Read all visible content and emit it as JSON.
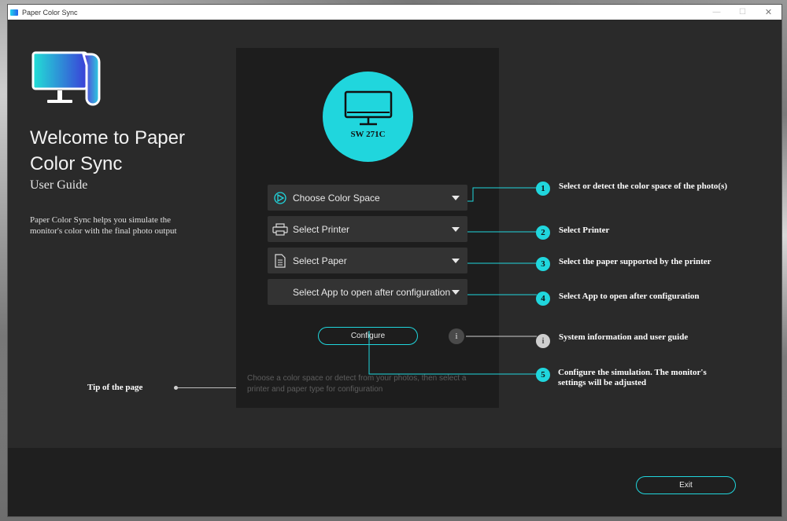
{
  "window": {
    "title": "Paper Color Sync",
    "minimize": "—",
    "maximize": "☐",
    "close": "✕"
  },
  "left": {
    "welcome": "Welcome to Paper Color Sync",
    "guide": "User Guide",
    "description": "Paper Color Sync helps you simulate the monitor's color with the final photo output",
    "tip_label": "Tip of the page"
  },
  "panel": {
    "model": "SW 271C",
    "selects": [
      {
        "label": "Choose Color Space",
        "icon": "color-space-icon"
      },
      {
        "label": "Select Printer",
        "icon": "printer-icon"
      },
      {
        "label": "Select Paper",
        "icon": "paper-icon"
      },
      {
        "label": "Select App to open after configuration",
        "icon": ""
      }
    ],
    "configure": "Configure",
    "info": "i",
    "tip": "Choose a color space or detect from your photos, then select a printer and paper type for configuration"
  },
  "annotations": [
    {
      "num": "1",
      "text": "Select or detect the color space of the photo(s)"
    },
    {
      "num": "2",
      "text": "Select Printer"
    },
    {
      "num": "3",
      "text": "Select the paper supported by the printer"
    },
    {
      "num": "4",
      "text": "Select App to open after configuration"
    },
    {
      "num": "i",
      "text": "System information and user guide"
    },
    {
      "num": "5",
      "text": "Configure the simulation. The monitor's settings will be adjusted"
    }
  ],
  "footer": {
    "exit": "Exit"
  },
  "colors": {
    "accent": "#20d6dd",
    "panel": "#1d1d1d",
    "background": "#2a2a2a"
  }
}
